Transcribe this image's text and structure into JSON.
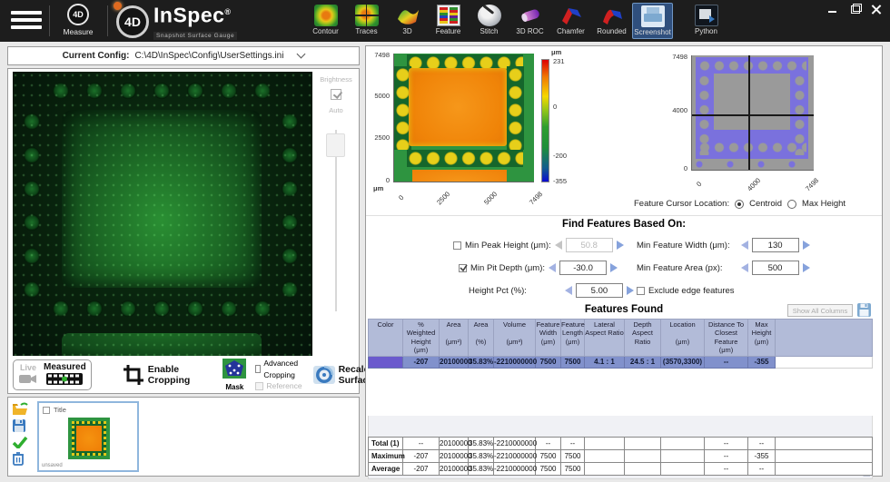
{
  "titlebar": {
    "measure": {
      "label": "Measure",
      "icon_text": "4D"
    },
    "logo": {
      "badge": "4D",
      "name": "InSpec",
      "reg": "®",
      "subtitle": "Snapshot Surface Gauge"
    },
    "tools": [
      {
        "label": "Contour"
      },
      {
        "label": "Traces"
      },
      {
        "label": "3D"
      },
      {
        "label": "Feature"
      },
      {
        "label": "Stitch"
      },
      {
        "label": "3D ROC"
      },
      {
        "label": "Chamfer"
      },
      {
        "label": "Rounded"
      },
      {
        "label": "Screenshot"
      },
      {
        "label": "Python"
      }
    ]
  },
  "config_bar": {
    "label": "Current Config:",
    "value": "C:\\4D\\InSpec\\Config\\UserSettings.ini"
  },
  "brightness": {
    "label": "Brightness",
    "auto": "Auto"
  },
  "controls": {
    "live": "Live",
    "measured": "Measured",
    "enable_cropping": "Enable\nCropping",
    "mask": "Mask",
    "advanced_cropping": "Advanced Cropping",
    "reference": "Reference",
    "recalculate": "Recalculate\nSurface"
  },
  "thumbnail_panel": {
    "title": "Title",
    "status": "unsaved"
  },
  "heatmap": {
    "y_ticks": [
      "7498",
      "5000",
      "2500",
      "0"
    ],
    "x_ticks": [
      "0",
      "2500",
      "5000",
      "7498"
    ],
    "unit": "μm",
    "colorbar_unit": "μm",
    "colorbar_ticks": [
      "231",
      "0",
      "-200",
      "-355"
    ],
    "colorbar_colors": [
      "#dd0000",
      "#f5d800",
      "#2f9e2f",
      "#0b0bd0"
    ]
  },
  "mask_plot": {
    "y_ticks": [
      "7498",
      "4000",
      "0"
    ],
    "x_ticks": [
      "0",
      "4000",
      "7498"
    ],
    "mask_color": "#7a71dd",
    "cursor": {
      "label": "Feature Cursor Location:",
      "centroid": "Centroid",
      "max_height": "Max Height"
    }
  },
  "find_features": {
    "title": "Find Features Based On:",
    "min_peak_height": {
      "label": "Min Peak Height (μm):",
      "value": "50.8",
      "checked": false,
      "enabled": false
    },
    "min_pit_depth": {
      "label": "Min Pit Depth (μm):",
      "value": "-30.0",
      "checked": true
    },
    "height_pct": {
      "label": "Height Pct (%):",
      "value": "5.00"
    },
    "min_feature_width": {
      "label": "Min Feature Width (μm):",
      "value": "130"
    },
    "min_feature_area": {
      "label": "Min Feature Area (px):",
      "value": "500"
    },
    "exclude_edge": {
      "label": "Exclude edge features",
      "checked": false
    }
  },
  "features_table": {
    "title": "Features Found",
    "show_all": "Show All Columns",
    "columns": [
      "Color",
      "% Weighted\nHeight\n(μm)",
      "Area\n\n(μm²)",
      "Area\n\n(%)",
      "Volume\n\n(μm³)",
      "Feature\nWidth\n(μm)",
      "Feature\nLength\n(μm)",
      "Lateral\nAspect Ratio",
      "Depth\nAspect Ratio",
      "Location\n\n(μm)",
      "Distance To\nClosest Feature\n(μm)",
      "Max\nHeight\n(μm)"
    ],
    "row": {
      "swatch": "#6a5acd",
      "values": [
        "-207",
        "20100000",
        "35.83%",
        "-2210000000",
        "7500",
        "7500",
        "4.1 : 1",
        "24.5 : 1",
        "(3570,3300)",
        "--",
        "-355"
      ]
    },
    "summary": [
      {
        "label": "Total (1)",
        "values": [
          "--",
          "20100000",
          "35.83%",
          "-2210000000",
          "--",
          "--",
          "",
          "",
          "",
          "--",
          "--"
        ]
      },
      {
        "label": "Maximum",
        "values": [
          "-207",
          "20100000",
          "35.83%",
          "-2210000000",
          "7500",
          "7500",
          "",
          "",
          "",
          "--",
          "-355"
        ]
      },
      {
        "label": "Average",
        "values": [
          "-207",
          "20100000",
          "35.83%",
          "-2210000000",
          "7500",
          "7500",
          "",
          "",
          "",
          "--",
          "--"
        ]
      }
    ]
  }
}
